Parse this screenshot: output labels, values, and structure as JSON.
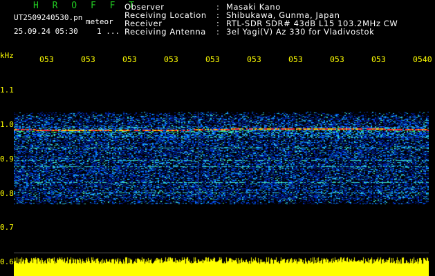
{
  "app": {
    "logo": "H R O F F T",
    "filename": "UT2509240530.pn",
    "filename_suffix": "meteor",
    "datetime": "25.09.24 05:30",
    "counter": "1 ..."
  },
  "info": {
    "rows": [
      {
        "label": "Observer",
        "value": "Masaki Kano"
      },
      {
        "label": "Receiving Location",
        "value": "Shibukawa, Gunma, Japan"
      },
      {
        "label": "Receiver",
        "value": "RTL-SDR SDR# 43dB L15 103.2MHz CW"
      },
      {
        "label": "Receiving Antenna",
        "value": "3el Yagi(V) Az 330 for Vladivostok"
      }
    ],
    "separator": ":"
  },
  "axis": {
    "unit": "kHz",
    "time_ticks": [
      "053",
      "053",
      "053",
      "053",
      "053",
      "053",
      "053",
      "053",
      "053",
      "0540"
    ],
    "freq_ticks": [
      "1.1",
      "1.0",
      "0.9",
      "0.8",
      "0.7",
      "0.6"
    ]
  },
  "colors": {
    "background": "#000000",
    "tick_text": "#ffff00",
    "logo": "#22cc22",
    "header_text": "#ffffff",
    "echo_line": "#ff3030",
    "amplitude": "#ffff00"
  }
}
